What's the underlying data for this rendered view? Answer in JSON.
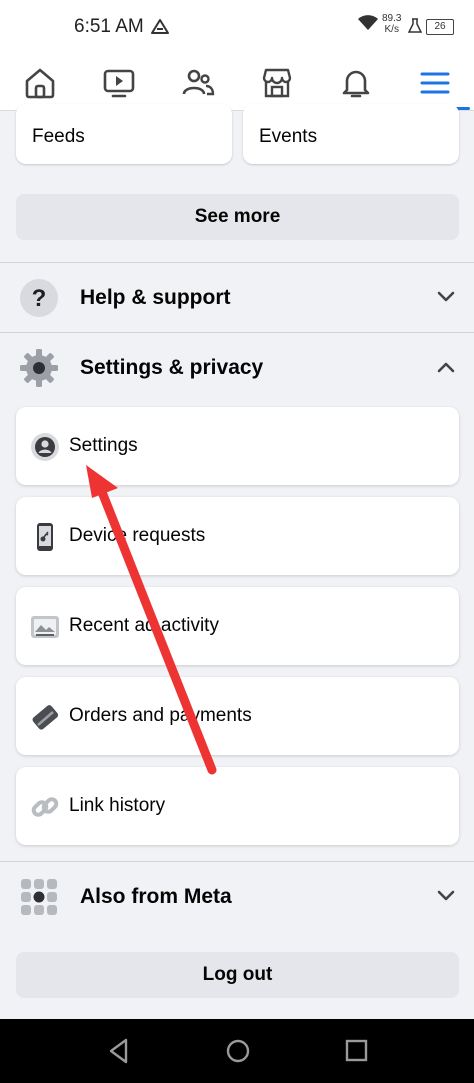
{
  "status_bar": {
    "time": "6:51 AM",
    "network_speed_value": "89.3",
    "network_speed_unit": "K/s",
    "battery": "26"
  },
  "nav": {
    "items": [
      {
        "name": "home-icon",
        "active": false
      },
      {
        "name": "video-icon",
        "active": false
      },
      {
        "name": "friends-icon",
        "active": false
      },
      {
        "name": "marketplace-icon",
        "active": false
      },
      {
        "name": "notifications-icon",
        "active": false
      },
      {
        "name": "menu-icon",
        "active": true
      }
    ],
    "active_color": "#1b74e4"
  },
  "shortcuts": {
    "feeds_label": "Feeds",
    "events_label": "Events",
    "see_more_label": "See more"
  },
  "help": {
    "label": "Help & support"
  },
  "settings_privacy": {
    "label": "Settings & privacy",
    "items": [
      {
        "label": "Settings",
        "icon": "profile-settings-icon"
      },
      {
        "label": "Device requests",
        "icon": "device-phone-icon"
      },
      {
        "label": "Recent ad activity",
        "icon": "ad-activity-icon"
      },
      {
        "label": "Orders and payments",
        "icon": "payment-card-icon"
      },
      {
        "label": "Link history",
        "icon": "link-icon"
      }
    ]
  },
  "also_from_meta": {
    "label": "Also from Meta"
  },
  "logout": {
    "label": "Log out"
  },
  "annotation": {
    "color": "#ee3333"
  }
}
